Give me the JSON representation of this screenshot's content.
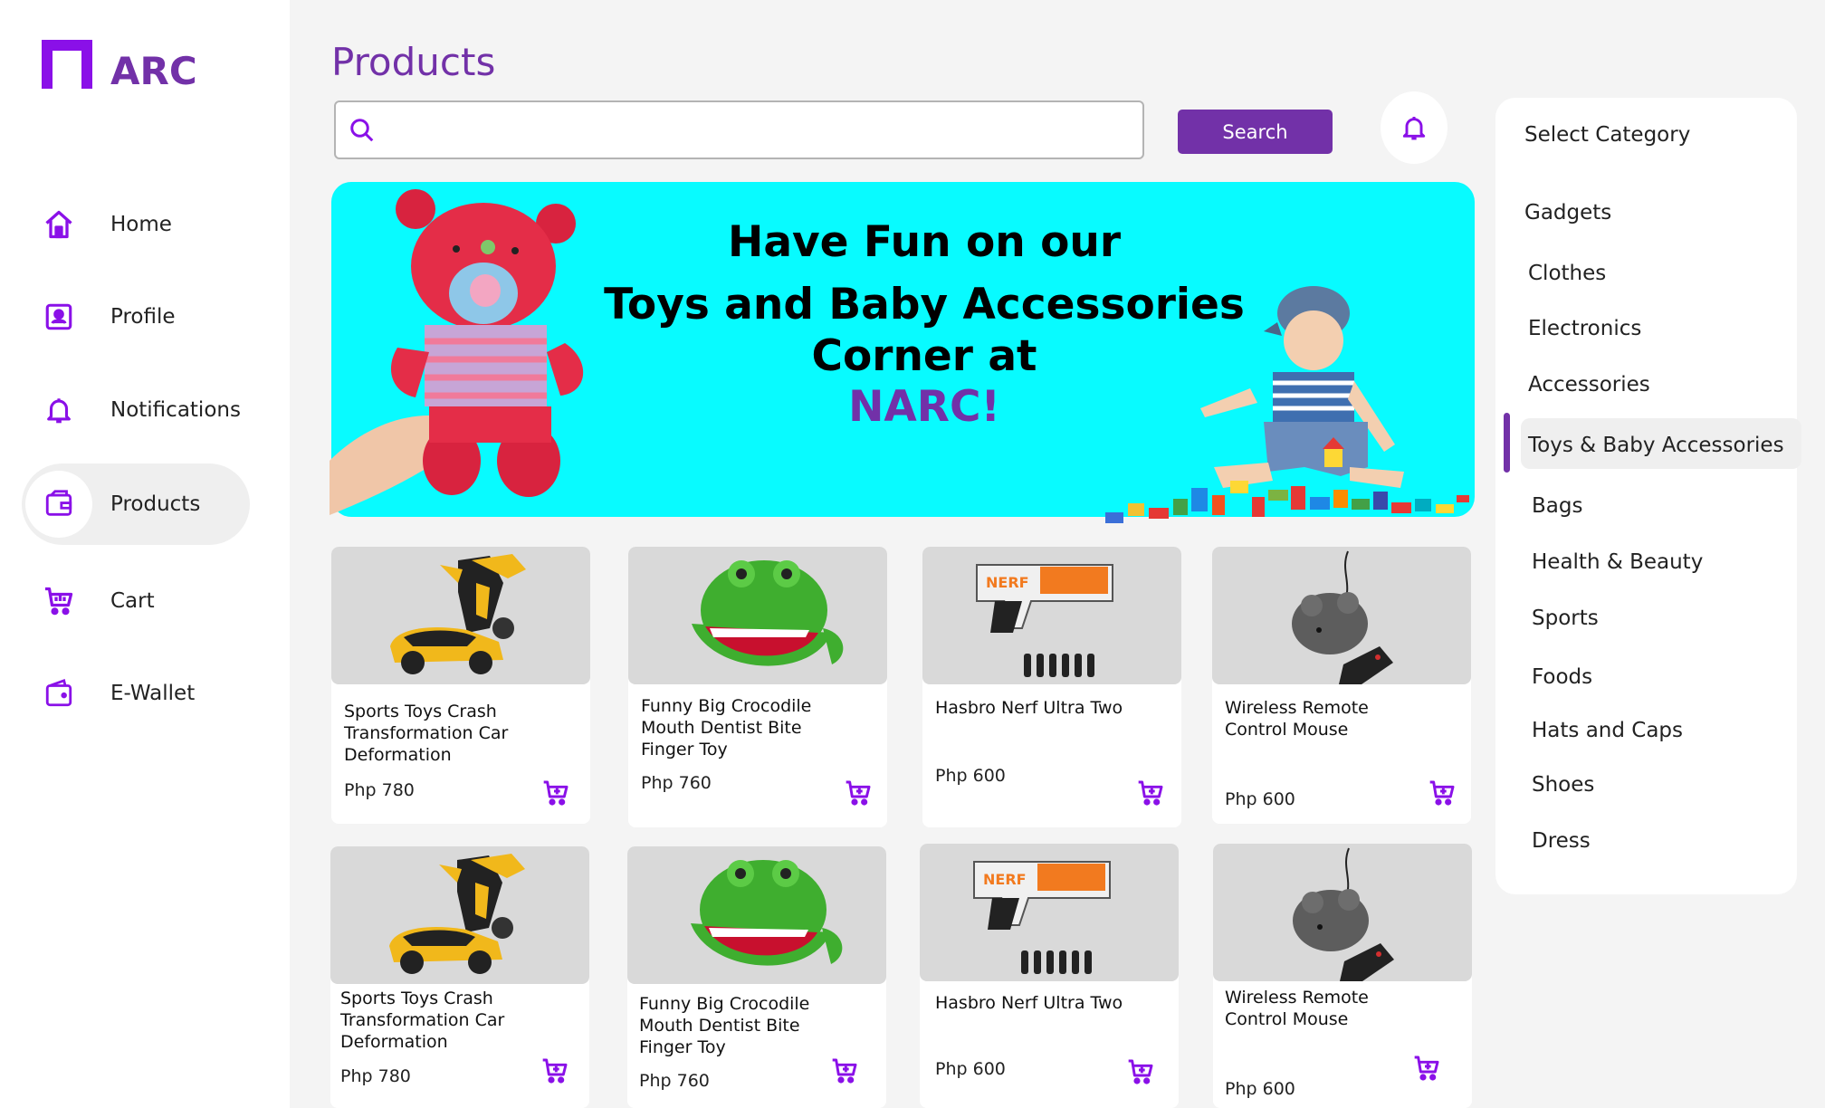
{
  "app": {
    "logo_text": "ARC",
    "accent": "#7231a8",
    "banner_color": "#08fbff"
  },
  "sidebar": {
    "items": [
      {
        "label": "Home",
        "icon": "home-icon"
      },
      {
        "label": "Profile",
        "icon": "profile-icon"
      },
      {
        "label": "Notifications",
        "icon": "bell-icon"
      },
      {
        "label": "Products",
        "icon": "wallet-box-icon",
        "active": true
      },
      {
        "label": "Cart",
        "icon": "cart-icon"
      },
      {
        "label": "E-Wallet",
        "icon": "wallet-icon"
      }
    ]
  },
  "header": {
    "title": "Products",
    "search_placeholder": "",
    "search_button": "Search"
  },
  "banner": {
    "line1": "Have Fun on our",
    "line2": "Toys and Baby Accessories Corner at",
    "brand": "NARC!"
  },
  "products": [
    {
      "name": "Sports Toys Crash Transformation Car Deformation",
      "price": "Php 780",
      "image": "transformer-car"
    },
    {
      "name": "Funny Big Crocodile Mouth Dentist Bite Finger Toy",
      "price": "Php 760",
      "image": "crocodile-toy"
    },
    {
      "name": "Hasbro Nerf Ultra Two",
      "price": "Php 600",
      "image": "nerf-blaster"
    },
    {
      "name": "Wireless Remote Control Mouse",
      "price": "Php 600",
      "image": "rc-mouse"
    },
    {
      "name": "Sports Toys Crash Transformation Car Deformation",
      "price": "Php 780",
      "image": "transformer-car"
    },
    {
      "name": "Funny Big Crocodile Mouth Dentist Bite Finger Toy",
      "price": "Php 760",
      "image": "crocodile-toy"
    },
    {
      "name": "Hasbro Nerf Ultra Two",
      "price": "Php 600",
      "image": "nerf-blaster"
    },
    {
      "name": "Wireless Remote Control Mouse",
      "price": "Php 600",
      "image": "rc-mouse"
    }
  ],
  "categories": {
    "heading": "Select Category",
    "items": [
      "Gadgets",
      "Clothes",
      "Electronics",
      "Accessories",
      "Toys & Baby Accessories",
      "Bags",
      "Health & Beauty",
      "Sports",
      "Foods",
      "Hats and Caps",
      "Shoes",
      "Dress"
    ],
    "selected": "Toys & Baby Accessories"
  }
}
